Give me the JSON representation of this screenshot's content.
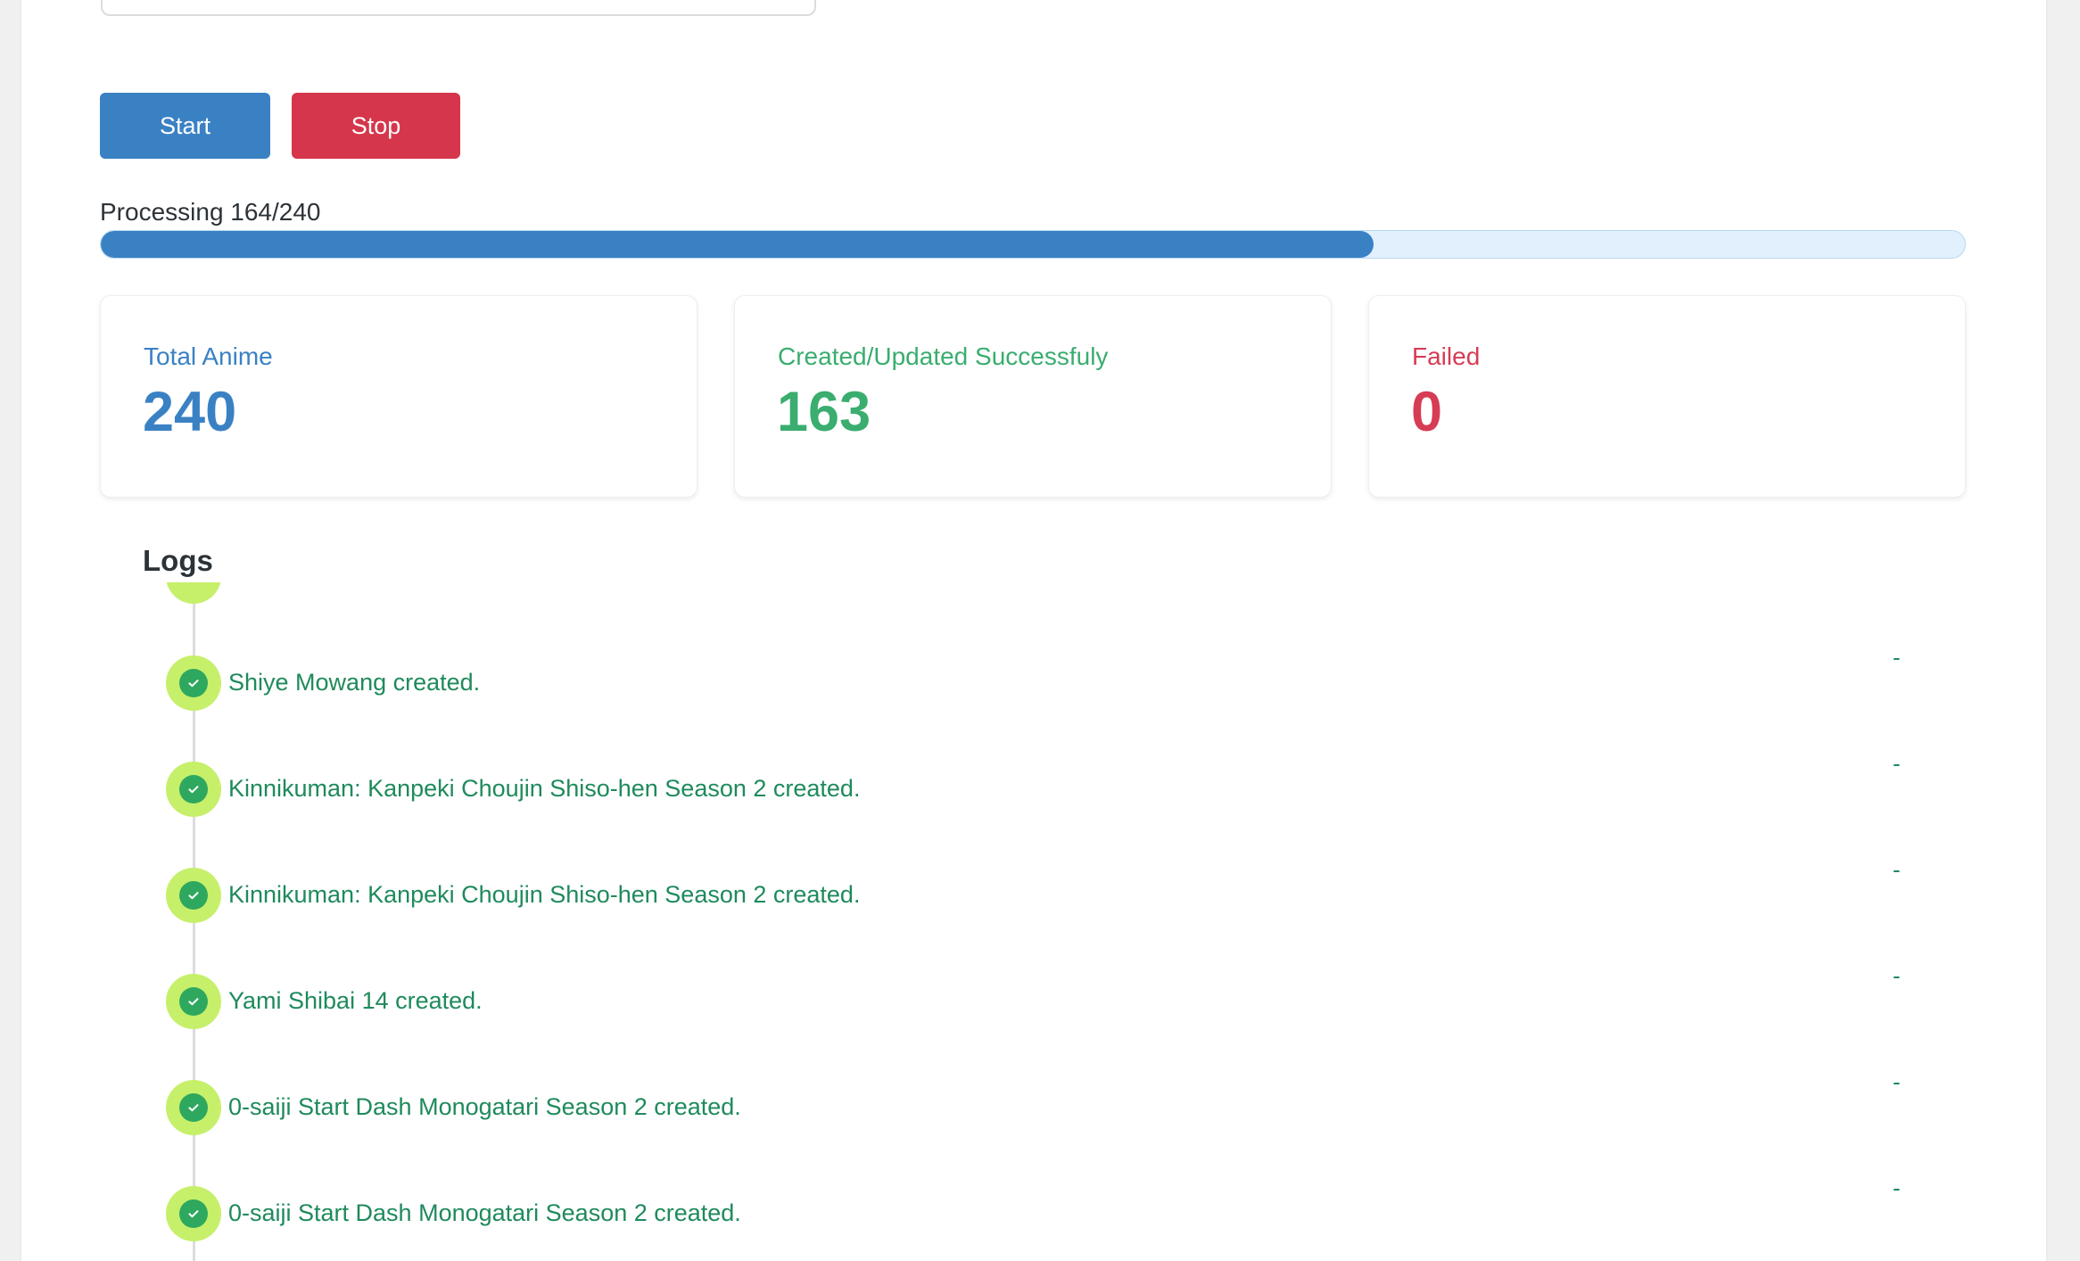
{
  "controls": {
    "start_label": "Start",
    "stop_label": "Stop"
  },
  "progress": {
    "label": "Processing 164/240",
    "fraction": 0.683
  },
  "stats": {
    "total": {
      "label": "Total Anime",
      "value": "240",
      "color": "#3a81c4"
    },
    "success": {
      "label": "Created/Updated Successfuly",
      "value": "163",
      "color": "#3aad6f"
    },
    "failed": {
      "label": "Failed",
      "value": "0",
      "color": "#d63c55"
    }
  },
  "logs": {
    "title": "Logs",
    "items": [
      {
        "text": "Shiye Mowang created.",
        "time": "-"
      },
      {
        "text": "Kinnikuman: Kanpeki Choujin Shiso-hen Season 2 created.",
        "time": "-"
      },
      {
        "text": "Kinnikuman: Kanpeki Choujin Shiso-hen Season 2 created.",
        "time": "-"
      },
      {
        "text": "Yami Shibai 14 created.",
        "time": "-"
      },
      {
        "text": "0-saiji Start Dash Monogatari Season 2 created.",
        "time": "-"
      },
      {
        "text": "0-saiji Start Dash Monogatari Season 2 created.",
        "time": "-"
      }
    ]
  },
  "icons": {
    "log_status": "check-circle-icon"
  }
}
